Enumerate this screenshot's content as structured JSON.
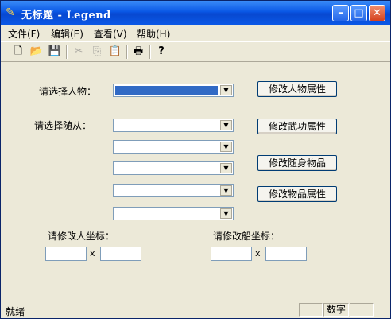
{
  "window": {
    "title": "无标题 - Legend",
    "controls": {
      "minimize": "–",
      "maximize": "□",
      "close": "✕"
    }
  },
  "menu": {
    "items": [
      "文件(F)",
      "编辑(E)",
      "查看(V)",
      "帮助(H)"
    ]
  },
  "toolbar": {
    "icons": [
      "new-icon",
      "open-icon",
      "save-icon",
      "cut-icon",
      "copy-icon",
      "paste-icon",
      "print-icon",
      "help-icon"
    ]
  },
  "form": {
    "select_person_label": "请选择人物：",
    "select_follower_label": "请选择随从：",
    "person_select": {
      "value": "",
      "highlighted": true
    },
    "follower_selects": [
      "",
      "",
      "",
      "",
      ""
    ],
    "buttons": {
      "edit_person": "修改人物属性",
      "edit_martial": "修改武功属性",
      "edit_carried": "修改随身物品",
      "edit_items": "修改物品属性"
    },
    "person_coord_label": "请修改人坐标：",
    "ship_coord_label": "请修改船坐标：",
    "coord_separator": "x",
    "person_x": "",
    "person_y": "",
    "ship_x": "",
    "ship_y": ""
  },
  "status": {
    "text": "就绪",
    "numlock": "数字"
  },
  "colors": {
    "titlebar": "#0a58e6",
    "selection": "#316ac5",
    "face": "#ece9d8"
  }
}
